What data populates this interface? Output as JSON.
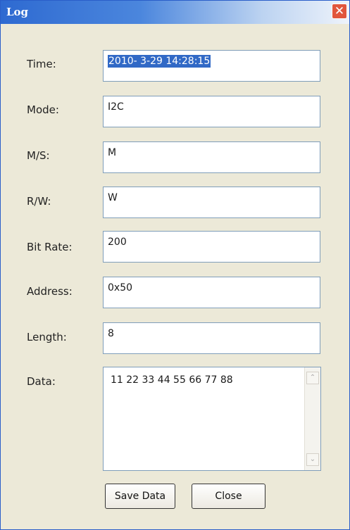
{
  "window": {
    "title": "Log",
    "close_glyph": "✕"
  },
  "fields": {
    "time": {
      "label": "Time:",
      "value": "2010- 3-29 14:28:15"
    },
    "mode": {
      "label": "Mode:",
      "value": "I2C"
    },
    "ms": {
      "label": "M/S:",
      "value": "M"
    },
    "rw": {
      "label": "R/W:",
      "value": "W"
    },
    "bitrate": {
      "label": "Bit Rate:",
      "value": "200"
    },
    "address": {
      "label": "Address:",
      "value": "0x50"
    },
    "length": {
      "label": "Length:",
      "value": "8"
    },
    "data": {
      "label": "Data:",
      "value": "11 22 33 44 55 66 77 88"
    }
  },
  "scrollbar": {
    "up_glyph": "⌃",
    "down_glyph": "⌄"
  },
  "buttons": {
    "save_label": "Save Data",
    "close_label": "Close"
  },
  "colors": {
    "titlebar_blue": "#2e6ad1",
    "selection_blue": "#3169c6",
    "dialog_bg": "#ece9d8",
    "close_red": "#e1563c"
  }
}
